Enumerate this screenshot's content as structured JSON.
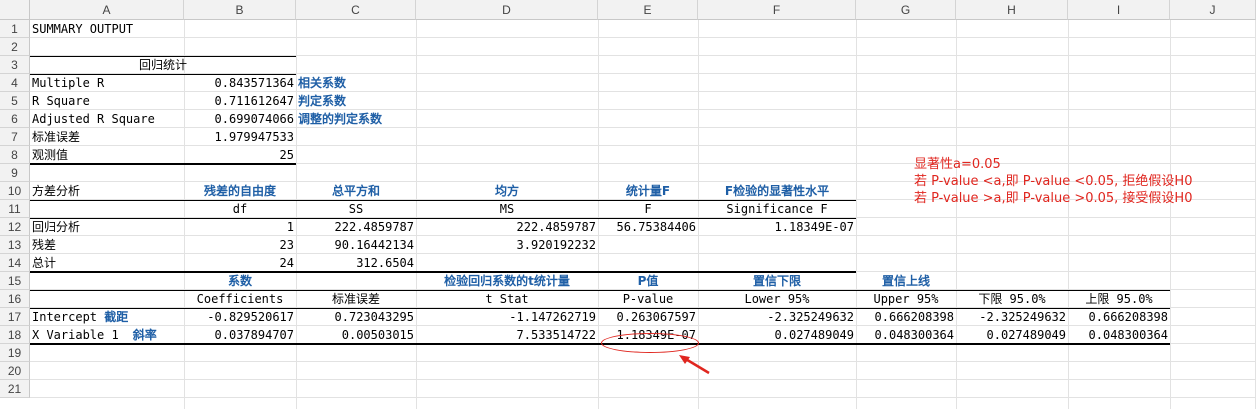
{
  "columns": [
    "A",
    "B",
    "C",
    "D",
    "E",
    "F",
    "G",
    "H",
    "I",
    "J"
  ],
  "rows": [
    "1",
    "2",
    "3",
    "4",
    "5",
    "6",
    "7",
    "8",
    "9",
    "10",
    "11",
    "12",
    "13",
    "14",
    "15",
    "16",
    "17",
    "18",
    "19",
    "20",
    "21"
  ],
  "summary": {
    "title": "SUMMARY OUTPUT",
    "reg_stats_header": "回归统计",
    "multiple_r_label": "Multiple R",
    "multiple_r": "0.843571364",
    "multiple_r_note": "相关系数",
    "r_square_label": "R Square",
    "r_square": "0.711612647",
    "r_square_note": "判定系数",
    "adj_r_label": "Adjusted R Square",
    "adj_r": "0.699074066",
    "adj_r_note": "调整的判定系数",
    "std_err_label": "标准误差",
    "std_err": "1.979947533",
    "obs_label": "观测值",
    "obs": "25"
  },
  "anova": {
    "title": "方差分析",
    "h_df_cn": "残差的自由度",
    "h_ss_cn": "总平方和",
    "h_ms_cn": "均方",
    "h_f_cn": "统计量F",
    "h_sig_cn": "F检验的显著性水平",
    "h_df": "df",
    "h_ss": "SS",
    "h_ms": "MS",
    "h_f": "F",
    "h_sig": "Significance F",
    "reg_label": "回归分析",
    "reg_df": "1",
    "reg_ss": "222.4859787",
    "reg_ms": "222.4859787",
    "reg_f": "56.75384406",
    "reg_sig": "1.18349E-07",
    "res_label": "残差",
    "res_df": "23",
    "res_ss": "90.16442134",
    "res_ms": "3.920192232",
    "tot_label": "总计",
    "tot_df": "24",
    "tot_ss": "312.6504"
  },
  "coef": {
    "h_coef_cn": "系数",
    "h_t_cn": "检验回归系数的t统计量",
    "h_p_cn": "P值",
    "h_lower_cn": "置信下限",
    "h_upper_cn": "置信上线",
    "h_coef": "Coefficients",
    "h_se": "标准误差",
    "h_t": "t Stat",
    "h_p": "P-value",
    "h_lower": "Lower 95%",
    "h_upper": "Upper 95%",
    "h_lower2": "下限 95.0%",
    "h_upper2": "上限 95.0%",
    "int_label": "Intercept",
    "int_note": "截距",
    "int_coef": "-0.829520617",
    "int_se": "0.723043295",
    "int_t": "-1.147262719",
    "int_p": "0.263067597",
    "int_lower": "-2.325249632",
    "int_upper": "0.666208398",
    "int_lower2": "-2.325249632",
    "int_upper2": "0.666208398",
    "x_label": "X Variable 1",
    "x_note": "斜率",
    "x_coef": "0.037894707",
    "x_se": "0.00503015",
    "x_t": "7.533514722",
    "x_p": "1.18349E-07",
    "x_lower": "0.027489049",
    "x_upper": "0.048300364",
    "x_lower2": "0.027489049",
    "x_upper2": "0.048300364"
  },
  "annotation": {
    "line1": "显著性a=0.05",
    "line2": "若 P-value <a,即 P-value <0.05, 拒绝假设H0",
    "line3": "若 P-value >a,即 P-value >0.05, 接受假设H0"
  },
  "colors": {
    "note_blue": "#1f5fa6",
    "annotation_red": "#e0261f",
    "header_bg": "#f2f2f2"
  }
}
